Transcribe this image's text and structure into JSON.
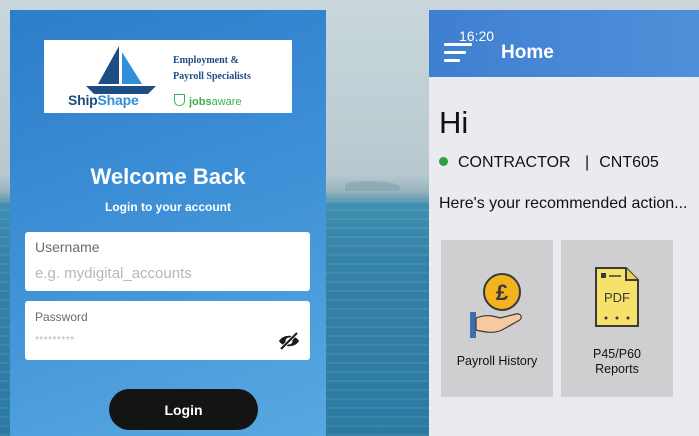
{
  "login": {
    "brand_ship": "Ship",
    "brand_shape": "Shape",
    "tagline_line1": "Employment &",
    "tagline_line2": "Payroll Specialists",
    "jobs_brand": "jobs",
    "jobs_aware": "aware",
    "welcome": "Welcome Back",
    "subtitle": "Login to your account",
    "username_label": "Username",
    "username_placeholder": "e.g. mydigital_accounts",
    "password_label": "Password",
    "password_mask": "*********",
    "login_button": "Login"
  },
  "home": {
    "time": "16:20",
    "title": "Home",
    "greeting": "Hi",
    "role": "CONTRACTOR",
    "separator": "|",
    "code": "CNT605",
    "recommended": "Here's your recommended action...",
    "tiles": [
      {
        "label": "Payroll History",
        "icon": "payroll-history-icon"
      },
      {
        "label_line1": "P45/P60",
        "label_line2": "Reports",
        "icon": "pdf-document-icon",
        "icon_text": "PDF"
      }
    ]
  },
  "colors": {
    "login_gradient": "#3d8fd6",
    "appbar": "#4a88d6",
    "status_dot": "#2aa147",
    "button_dark": "#141414",
    "tile_bg": "#cfcfd1"
  }
}
